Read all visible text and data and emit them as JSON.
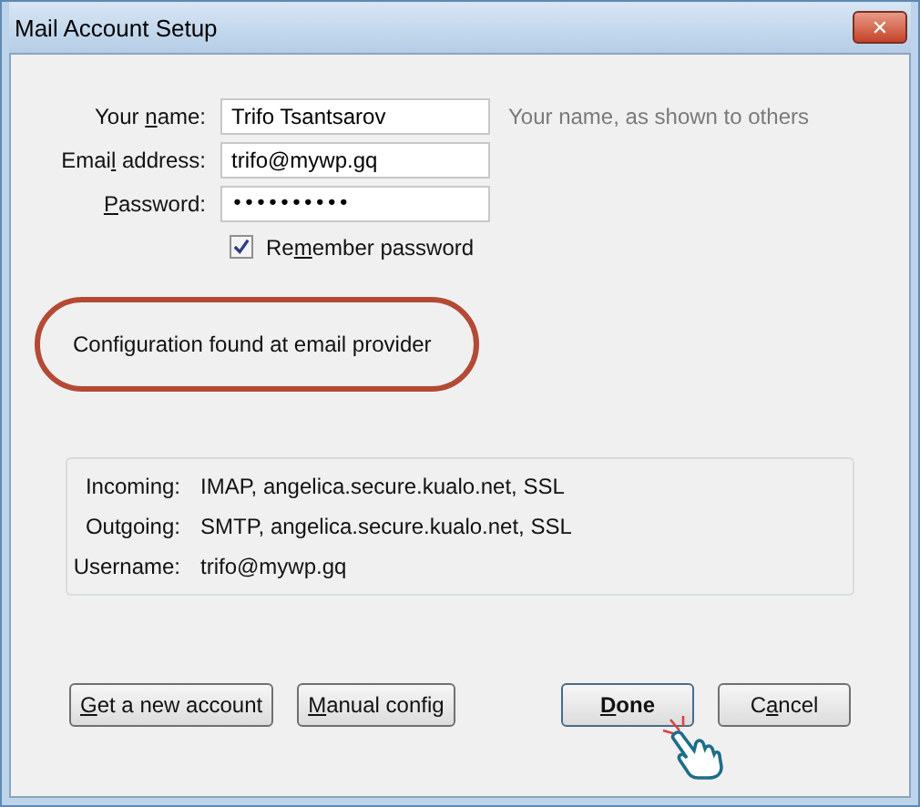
{
  "window": {
    "title": "Mail Account Setup",
    "close": "✕"
  },
  "form": {
    "fields": [
      {
        "label": {
          "pre": "Your ",
          "key": "n",
          "post": "ame:"
        },
        "value": "Trifo Tsantsarov",
        "kind": "text",
        "hint": "Your name, as shown to others"
      },
      {
        "label": {
          "pre": "Emai",
          "key": "l",
          "post": " address:"
        },
        "value": "trifo@mywp.gq",
        "kind": "text"
      },
      {
        "label": {
          "key": "P",
          "post": "assword:"
        },
        "value": "••••••••••",
        "kind": "password"
      }
    ],
    "remember": {
      "label": {
        "pre": "Re",
        "key": "m",
        "post": "ember password"
      },
      "checked": true
    }
  },
  "status": {
    "text": "Configuration found at email provider",
    "highlighted": true
  },
  "settings": [
    {
      "label": "Incoming:",
      "value": "IMAP, angelica.secure.kualo.net, SSL"
    },
    {
      "label": "Outgoing:",
      "value": "SMTP, angelica.secure.kualo.net, SSL"
    },
    {
      "label": "Username:",
      "value": "trifo@mywp.gq"
    }
  ],
  "buttons_left": [
    {
      "label": {
        "key": "G",
        "post": "et a new account"
      }
    },
    {
      "label": {
        "key": "M",
        "post": "anual config"
      }
    }
  ],
  "buttons_right": [
    {
      "label": {
        "key": "D",
        "post": "one"
      },
      "default": true
    },
    {
      "label": {
        "pre": "C",
        "key": "a",
        "post": "ncel"
      },
      "default": false
    }
  ]
}
